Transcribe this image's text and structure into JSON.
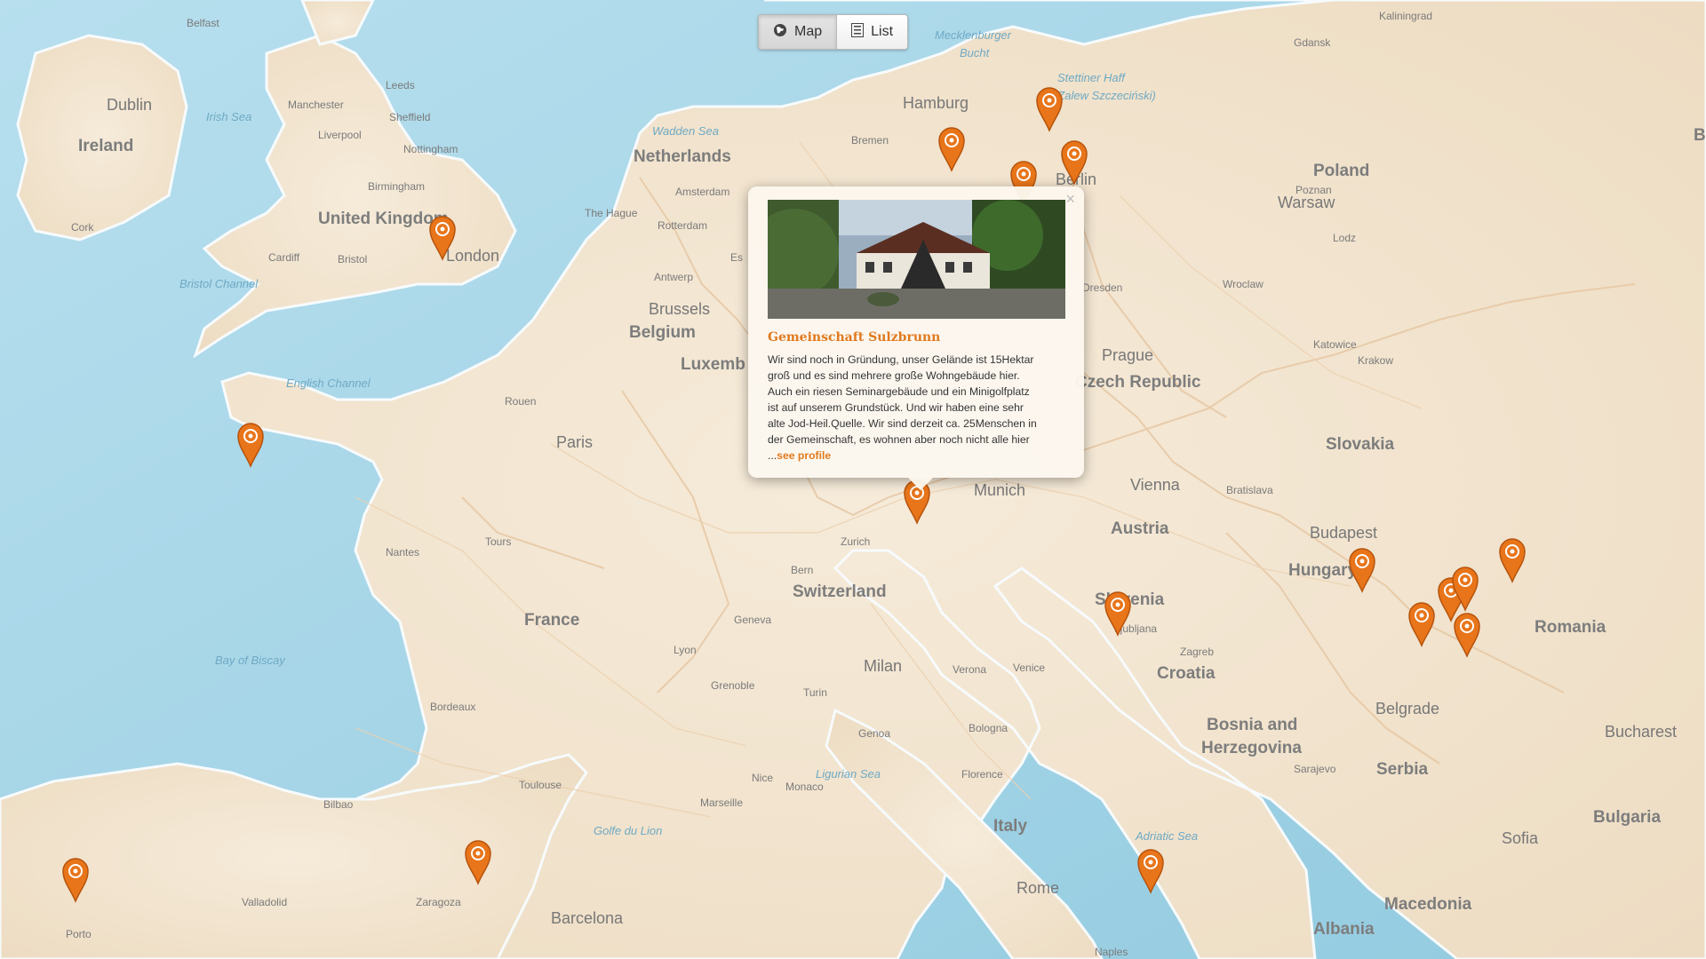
{
  "view_toggle": {
    "map_label": "Map",
    "list_label": "List",
    "map_icon": "globe-icon",
    "list_icon": "list-icon",
    "active": "Map"
  },
  "colors": {
    "accent": "#e07a1e",
    "marker": "#e8751a",
    "water": "#a9d6e6",
    "land": "#f3e7d4",
    "border": "#e7c9a6"
  },
  "popup": {
    "title": "Gemeinschaft Sulzbrunn",
    "description_lines": [
      "Wir sind noch in Gründung, unser Gelände ist 15Hektar",
      "groß und es sind mehrere große Wohngebäude hier.",
      "Auch ein riesen Seminargebäude und ein Minigolfplatz",
      "ist auf unserem Grundstück. Und wir haben eine sehr",
      "alte Jod-Heil.Quelle. Wir sind derzeit ca. 25Menschen in",
      "der Gemeinschaft, es wohnen aber noch nicht alle hier"
    ],
    "ellipsis": "...",
    "link_label": "see profile",
    "close_label": "×"
  },
  "map_labels": {
    "countries": [
      "Ireland",
      "United Kingdom",
      "Netherlands",
      "Belgium",
      "Luxemb",
      "France",
      "Switzerland",
      "Poland",
      "Czech Republic",
      "Slovakia",
      "Austria",
      "Hungary",
      "Slovenia",
      "Croatia",
      "Romania",
      "Bosnia and",
      "Herzegovina",
      "Serbia",
      "Bulgaria",
      "Italy",
      "Macedonia",
      "Albania",
      "Bela"
    ],
    "cities_major": [
      "Dublin",
      "London",
      "Paris",
      "Brussels",
      "Hamburg",
      "Berlin",
      "Prague",
      "Warsaw",
      "Munich",
      "Vienna",
      "Budapest",
      "Milan",
      "Rome",
      "Barcelona",
      "Belgrade",
      "Bucharest",
      "Sofia"
    ],
    "cities_minor": [
      "Belfast",
      "Leeds",
      "Manchester",
      "Sheffield",
      "Liverpool",
      "Nottingham",
      "Birmingham",
      "Cork",
      "Cardiff",
      "Bristol",
      "Amsterdam",
      "The Hague",
      "Rotterdam",
      "Antwerp",
      "Bremen",
      "Gdansk",
      "Kaliningrad",
      "Poznan",
      "Lodz",
      "Wroclaw",
      "Katowice",
      "Krakow",
      "Dresden",
      "Rouen",
      "Tours",
      "Nantes",
      "Bordeaux",
      "Toulouse",
      "Lyon",
      "Geneva",
      "Grenoble",
      "Turin",
      "Bern",
      "Zurich",
      "Verona",
      "Venice",
      "Bologna",
      "Genoa",
      "Florence",
      "Nice",
      "Monaco",
      "Marseille",
      "Bilbao",
      "Valladolid",
      "Zaragoza",
      "Porto",
      "Naples",
      "Ljubljana",
      "Zagreb",
      "Bratislava",
      "Sarajevo",
      "Es"
    ],
    "waters": [
      "Irish Sea",
      "Bristol Channel",
      "English Channel",
      "Bay of Biscay",
      "Wadden Sea",
      "Mecklenburger Bucht",
      "Stettiner Haff (Zalew Szczeciński)",
      "Ligurian Sea",
      "Golfe du Lion",
      "Adriatic Sea"
    ]
  }
}
